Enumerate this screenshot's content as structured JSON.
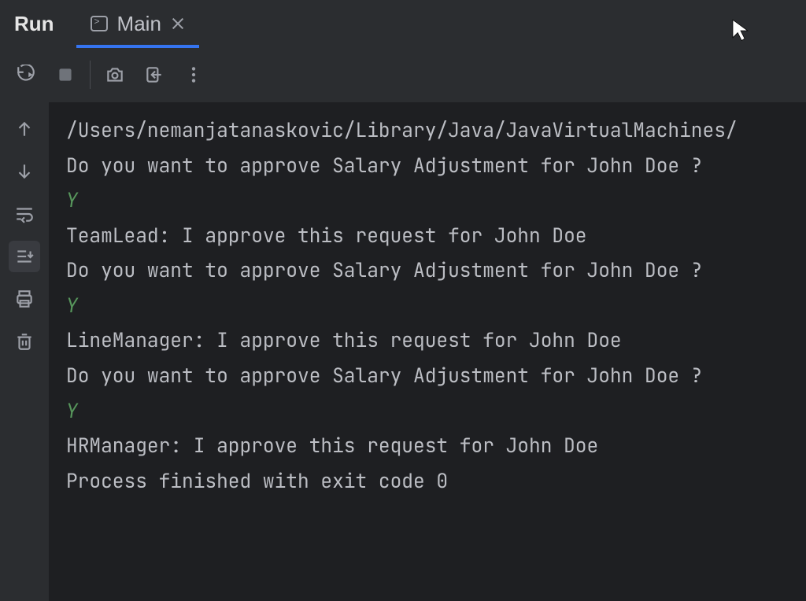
{
  "panel": {
    "title": "Run"
  },
  "tab": {
    "label": "Main"
  },
  "console": {
    "lines": [
      {
        "text": "/Users/nemanjatanaskovic/Library/Java/JavaVirtualMachines/",
        "kind": "out"
      },
      {
        "text": "Do you want to approve Salary Adjustment for John Doe ?",
        "kind": "out"
      },
      {
        "text": "Y",
        "kind": "in"
      },
      {
        "text": "TeamLead: I approve this request for John Doe",
        "kind": "out"
      },
      {
        "text": "Do you want to approve Salary Adjustment for John Doe ?",
        "kind": "out"
      },
      {
        "text": "Y",
        "kind": "in"
      },
      {
        "text": "LineManager: I approve this request for John Doe",
        "kind": "out"
      },
      {
        "text": "Do you want to approve Salary Adjustment for John Doe ?",
        "kind": "out"
      },
      {
        "text": "Y",
        "kind": "in"
      },
      {
        "text": "HRManager: I approve this request for John Doe",
        "kind": "out"
      },
      {
        "text": "",
        "kind": "out"
      },
      {
        "text": "Process finished with exit code 0",
        "kind": "out"
      }
    ]
  }
}
